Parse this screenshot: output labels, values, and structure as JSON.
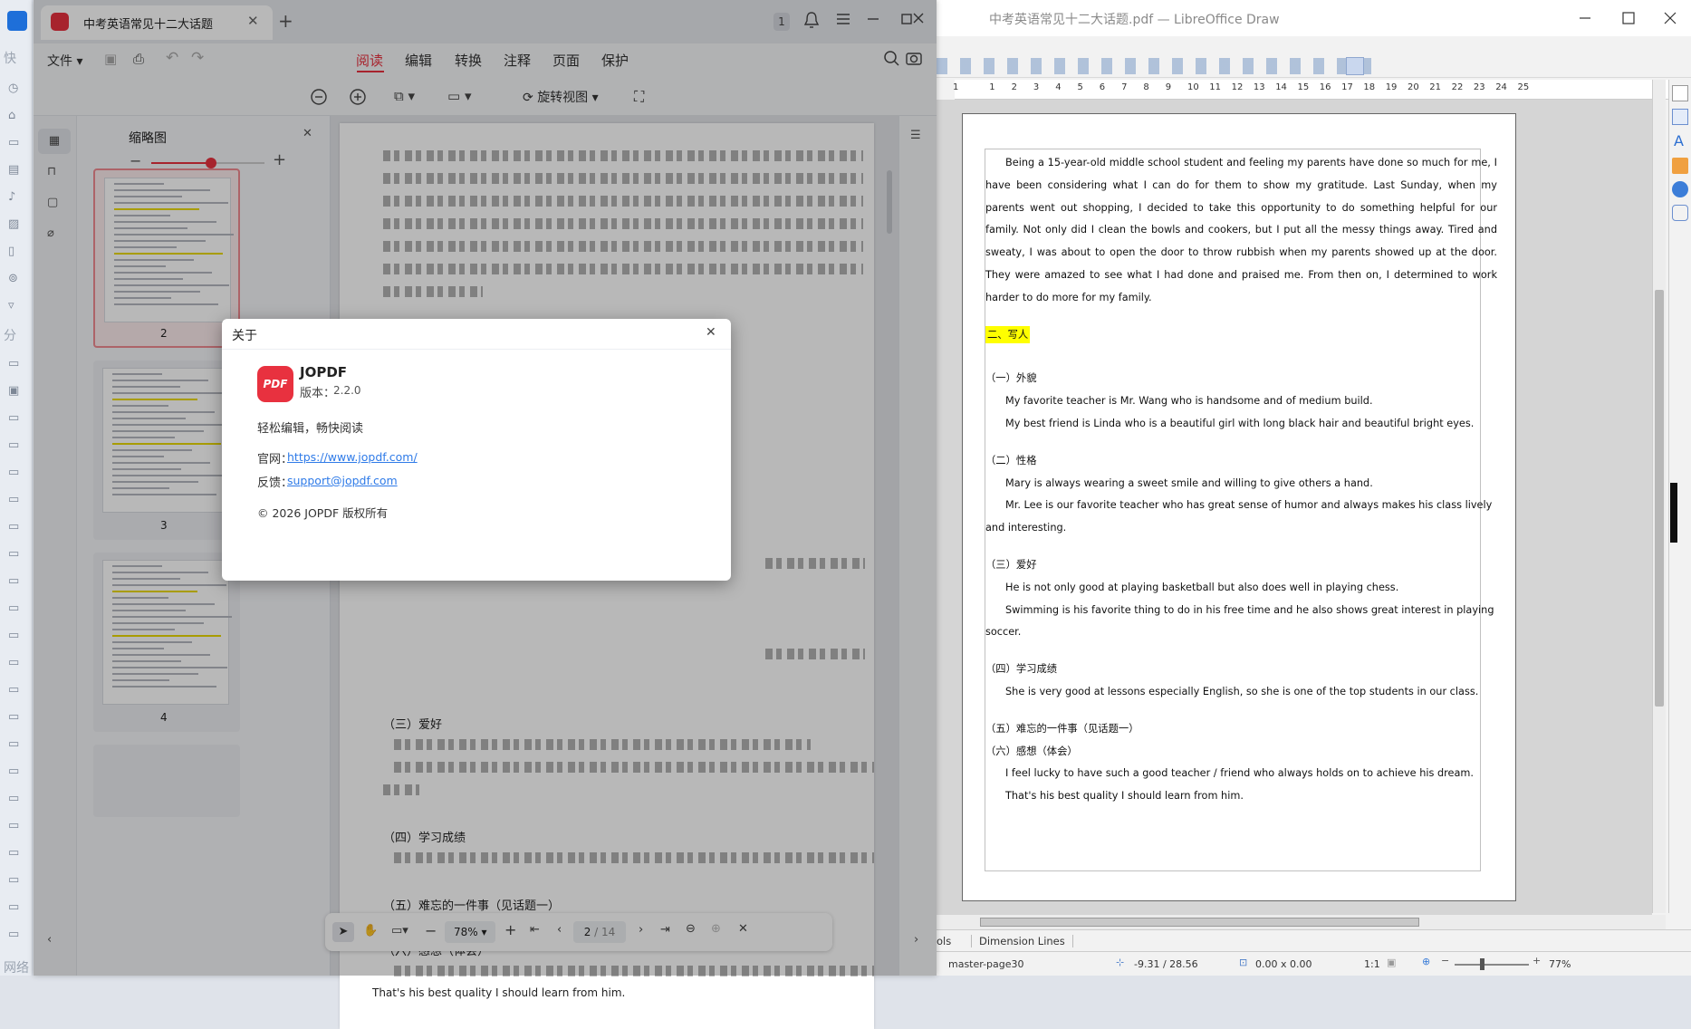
{
  "desktop": {
    "labels": [
      "快",
      "分",
      "网络"
    ]
  },
  "lo": {
    "title": "中考英语常见十二大话题.pdf — LibreOffice Draw",
    "ruler_ticks": [
      "1",
      "1",
      "2",
      "3",
      "4",
      "5",
      "6",
      "7",
      "8",
      "9",
      "10",
      "11",
      "12",
      "13",
      "14",
      "15",
      "16",
      "17",
      "18",
      "19",
      "20",
      "21",
      "22",
      "23",
      "24",
      "25"
    ],
    "paragraphs": [
      {
        "text": "Being a 15-year-old middle school student and feeling my parents have done so much for me, I have been considering what I can do for them to show my gratitude. Last Sunday, when my parents went out shopping, I decided to take this opportunity to do something helpful for our family. Not only did I clean the bowls and cookers, but I put all the messy things away. Tired and sweaty, I was about to open the door to throw rubbish when my parents showed up at the door. They were amazed to see what I had done and praised me. From then on, I determined to work harder to do more for my family."
      },
      {
        "heading": "二、写人"
      },
      {
        "sub": "（一）外貌"
      },
      {
        "line": "My favorite teacher is Mr. Wang who is handsome and of medium build."
      },
      {
        "line": "My best friend is Linda who is a beautiful girl with long black hair and beautiful bright eyes."
      },
      {
        "sub": "（二）性格"
      },
      {
        "line": "Mary is always wearing a sweet smile and willing to give others a hand."
      },
      {
        "line": "Mr. Lee is our favorite teacher who has great sense of humor and always makes his class lively and interesting."
      },
      {
        "sub": "（三）爱好"
      },
      {
        "line": "He is not only good at playing basketball but also does well in playing chess."
      },
      {
        "line": "Swimming is his favorite thing to do in his free time and he also shows great interest in playing soccer."
      },
      {
        "sub": "（四）学习成绩"
      },
      {
        "line": "She is very good at lessons especially English, so she is one of the top students in our class."
      },
      {
        "sub": "（五）难忘的一件事（见话题一）"
      },
      {
        "sub": "（六）感想（体会）"
      },
      {
        "line": "I feel lucky to have such a good teacher / friend who always holds on to achieve his dream."
      },
      {
        "line": "That's his best quality I should learn from him."
      }
    ],
    "tabs": [
      "ols",
      "Dimension Lines"
    ],
    "status": {
      "page": "master-page30",
      "position": "-9.31 / 28.56",
      "size": "0.00 x 0.00",
      "ratio": "1:1",
      "zoom": "77%"
    }
  },
  "jp": {
    "tab_title": "中考英语常见十二大话题",
    "tab_badge": "1",
    "file_menu": "文件",
    "menu": [
      "阅读",
      "编辑",
      "转换",
      "注释",
      "页面",
      "保护"
    ],
    "rotate_label": "旋转视图",
    "thumb_panel_title": "缩略图",
    "thumb_numbers": [
      "2",
      "3",
      "4"
    ],
    "page_lines": {
      "h3": "（三）爱好",
      "h4": "（四）学习成绩",
      "h5": "（五）难忘的一件事（见话题一）",
      "h6": "（六）感想（体会）",
      "last": "That's his best quality I should learn from him."
    },
    "zoom": "78%",
    "page_current": "2",
    "page_total": "/ 14"
  },
  "dialog": {
    "title": "关于",
    "app_name": "JOPDF",
    "logo_text": "PDF",
    "version_label": "版本：",
    "version": "2.2.0",
    "slogan": "轻松编辑，畅快阅读",
    "site_label": "官网：",
    "site_url": "https://www.jopdf.com/",
    "feedback_label": "反馈：",
    "feedback_email": "support@jopdf.com",
    "copyright": "© 2026 JOPDF 版权所有"
  },
  "colors": {
    "accent": "#e8313f",
    "link": "#2f7be8",
    "highlight": "#ffff00"
  }
}
